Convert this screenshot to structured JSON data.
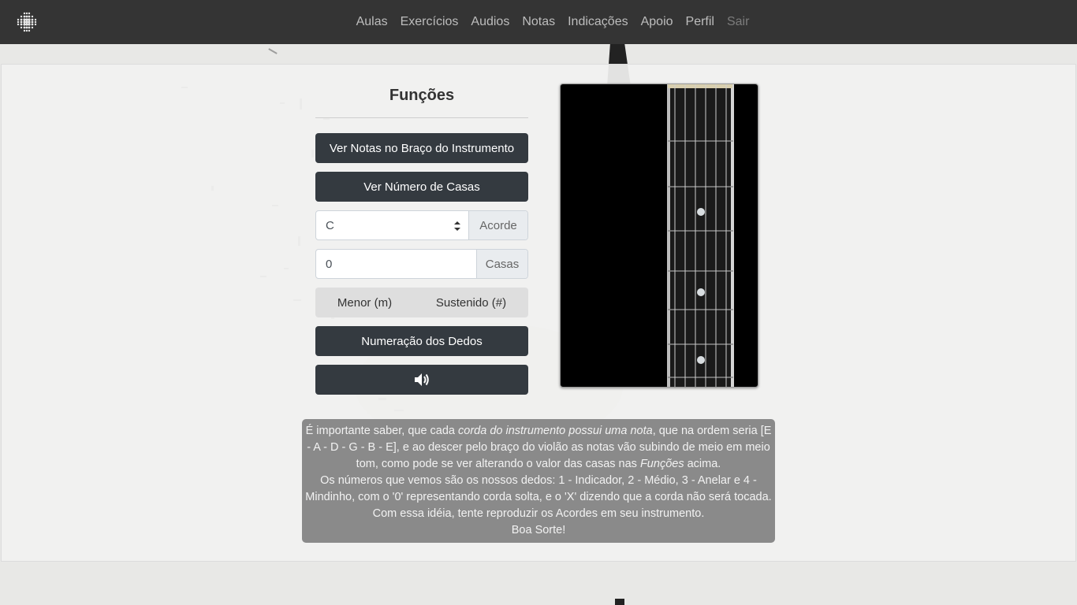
{
  "nav": {
    "logo_icon": "dotted-circle-logo-icon",
    "links": [
      "Aulas",
      "Exercícios",
      "Audios",
      "Notas",
      "Indicações",
      "Apoio",
      "Perfil",
      "Sair"
    ]
  },
  "functions": {
    "title": "Funções",
    "notes_button": "Ver Notas no Braço do Instrumento",
    "frets_button": "Ver Número de Casas",
    "chord_select": {
      "value": "C",
      "addon": "Acorde"
    },
    "frets_input": {
      "value": "0",
      "addon": "Casas"
    },
    "minor_option": "Menor (m)",
    "sharp_option": "Sustenido (#)",
    "fingers_button": "Numeração dos Dedos",
    "sound_icon": "volume-up-icon"
  },
  "info": {
    "p1_a": "É importante saber, que cada ",
    "p1_em": "corda do instrumento possui uma nota",
    "p1_b": ", que na ordem seria [E - A - D - G - B - E], e ao descer pelo braço do violão as notas vão subindo de meio em meio tom, como pode se ver alterando o valor das casas nas ",
    "p1_em2": "Funções",
    "p1_c": " acima.",
    "p2": "Os números que vemos são os nossos dedos: 1 - Indicador, 2 - Médio, 3 - Anelar e 4 - Mindinho, com o '0' representando corda solta, e o 'X' dizendo que a corda não será tocada. Com essa idéia, tente reproduzir os Acordes em seu instrumento.",
    "p3": "Boa Sorte!"
  },
  "colors": {
    "navbar": "#343434",
    "button_dark": "#343a40",
    "info_box": "#787878"
  }
}
